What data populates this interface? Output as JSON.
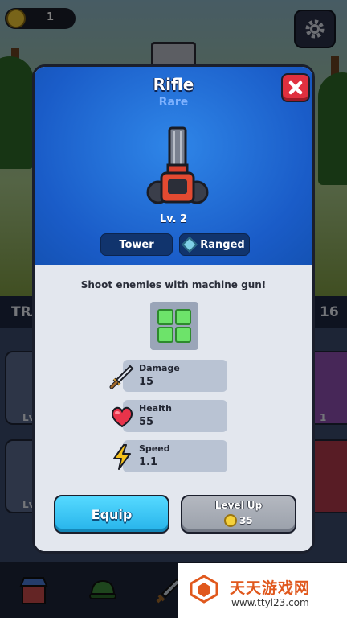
{
  "hud": {
    "coin_count": "1",
    "icons": [
      "coin-icon",
      "gear-icon"
    ]
  },
  "background": {
    "strip_left": "TRA",
    "strip_right": "16",
    "card_levels": [
      "Lv",
      "Lv",
      "1"
    ]
  },
  "modal": {
    "title": "Rifle",
    "rarity": "Rare",
    "level": "Lv. 2",
    "tags": [
      {
        "label": "Tower"
      },
      {
        "label": "Ranged",
        "icon": "ranged-icon"
      }
    ],
    "description": "Shoot enemies with machine gun!",
    "stats": [
      {
        "label": "Damage",
        "value": "15",
        "icon": "sword-icon"
      },
      {
        "label": "Health",
        "value": "55",
        "icon": "heart-icon"
      },
      {
        "label": "Speed",
        "value": "1.1",
        "icon": "lightning-icon"
      }
    ],
    "equip_label": "Equip",
    "level_up": {
      "label": "Level Up",
      "cost": "35",
      "icon": "coin-icon"
    },
    "close_icon": "close-icon"
  },
  "colors": {
    "header_blue": "#1a5cc8",
    "rarity_text": "#7fb2ff",
    "equip_button": "#26b3ea",
    "close_button": "#e0303f",
    "level_up_button": "#9aa0aa"
  },
  "watermark": {
    "title": "天天游戏网",
    "url": "www.ttyl23.com"
  }
}
